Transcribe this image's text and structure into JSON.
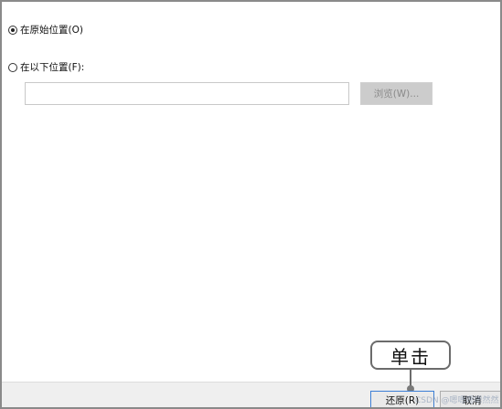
{
  "options": {
    "original_location_label": "在原始位置(O)",
    "other_location_label": "在以下位置(F):",
    "path_value": "",
    "browse_label": "浏览(W)..."
  },
  "footer": {
    "restore_label": "还原(R)",
    "cancel_label": "取消"
  },
  "callout": {
    "text": "单击"
  },
  "watermark": {
    "text": "CSDN @嗯嗯嗯嗯然然"
  },
  "colors": {
    "accent": "#3c7fd6",
    "disabled_bg": "#cccccc",
    "disabled_text": "#8a8a8a"
  }
}
